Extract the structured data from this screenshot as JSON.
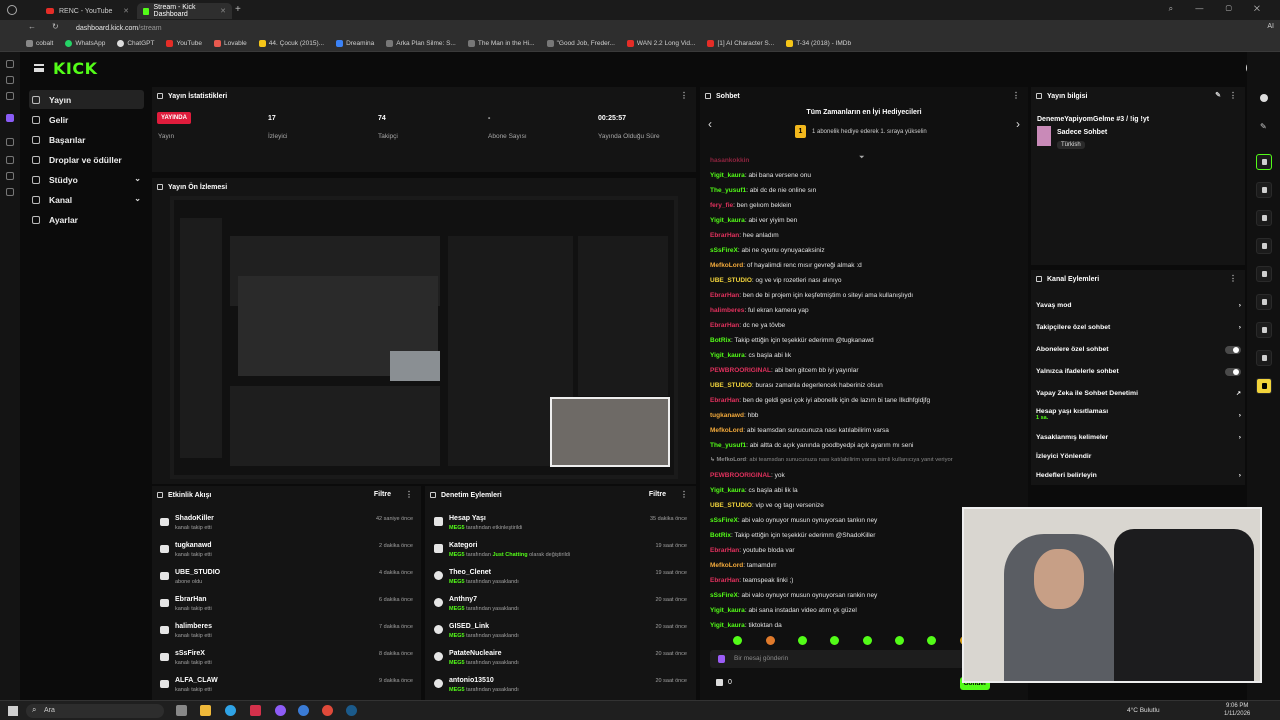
{
  "browser": {
    "tabs": [
      {
        "label": "RENC - YouTube"
      },
      {
        "label": "Stream - Kick Dashboard"
      }
    ],
    "url_host": "dashboard.kick.com",
    "url_path": "/stream",
    "bookmarks": [
      "cobalt",
      "WhatsApp",
      "ChatGPT",
      "YouTube",
      "Lovable",
      "44. Çocuk (2015)...",
      "Dreamina",
      "Arka Plan Silme: S...",
      "The Man in the Hi...",
      "\"Good Job, Freder...",
      "WAN 2.2 Long Vid...",
      "[1] AI Character S...",
      "T-34 (2018) - IMDb"
    ],
    "zoom_label": "AI"
  },
  "sidebar": {
    "logo": "KICK",
    "items": [
      {
        "label": "Yayın"
      },
      {
        "label": "Gelir"
      },
      {
        "label": "Başarılar"
      },
      {
        "label": "Droplar ve ödüller"
      },
      {
        "label": "Stüdyo"
      },
      {
        "label": "Kanal"
      },
      {
        "label": "Ayarlar"
      }
    ]
  },
  "stats": {
    "title": "Yayın İstatistikleri",
    "live_badge": "YAYINDA",
    "live_label": "Yayın",
    "viewers_value": "17",
    "viewers_label": "İzleyici",
    "followers_value": "74",
    "followers_label": "Takipçi",
    "subs_value": "-",
    "subs_label": "Abone Sayısı",
    "uptime_value": "00:25:57",
    "uptime_label": "Yayında Olduğu Süre"
  },
  "preview": {
    "title": "Yayın Ön İzlemesi"
  },
  "activity": {
    "title": "Etkinlik Akışı",
    "filter": "Filtre",
    "items": [
      {
        "name": "ShadoKiller",
        "sub": "kanalı takip etti",
        "time": "42 saniye önce"
      },
      {
        "name": "tugkanawd",
        "sub": "kanalı takip etti",
        "time": "2 dakika önce"
      },
      {
        "name": "UBE_STUDIO",
        "sub": "abone oldu",
        "time": "4 dakika önce"
      },
      {
        "name": "EbrarHan",
        "sub": "kanalı takip etti",
        "time": "6 dakika önce"
      },
      {
        "name": "halimberes",
        "sub": "kanalı takip etti",
        "time": "7 dakika önce"
      },
      {
        "name": "sSsFireX",
        "sub": "kanalı takip etti",
        "time": "8 dakika önce"
      },
      {
        "name": "ALFA_CLAW",
        "sub": "kanalı takip etti",
        "time": "9 dakika önce"
      }
    ]
  },
  "moderation": {
    "title": "Denetim Eylemleri",
    "filter": "Filtre",
    "items": [
      {
        "name": "Hesap Yaşı",
        "actor": "MEG5",
        "rest": "tarafından etkinleştirildi",
        "extra": "",
        "tail": "",
        "time": "35 dakika önce"
      },
      {
        "name": "Kategori",
        "actor": "MEG5",
        "rest": "tarafından",
        "extra": "Just Chatting",
        "tail": "olarak değiştirildi",
        "time": "19 saat önce"
      },
      {
        "name": "Theo_Clenet",
        "actor": "MEG5",
        "rest": "tarafından yasaklandı",
        "extra": "",
        "tail": "",
        "time": "19 saat önce"
      },
      {
        "name": "Anthny7",
        "actor": "MEG5",
        "rest": "tarafından yasaklandı",
        "extra": "",
        "tail": "",
        "time": "20 saat önce"
      },
      {
        "name": "GISED_Link",
        "actor": "MEG5",
        "rest": "tarafından yasaklandı",
        "extra": "",
        "tail": "",
        "time": "20 saat önce"
      },
      {
        "name": "PatateNucleaire",
        "actor": "MEG5",
        "rest": "tarafından yasaklandı",
        "extra": "",
        "tail": "",
        "time": "20 saat önce"
      },
      {
        "name": "antonio13510",
        "actor": "MEG5",
        "rest": "tarafından yasaklandı",
        "extra": "",
        "tail": "",
        "time": "20 saat önce"
      }
    ]
  },
  "chat": {
    "title": "Sohbet",
    "gift_title": "Tüm Zamanların en İyi Hediyecileri",
    "gift_rank": "1",
    "gift_sub": "1 abonelik hediye ederek 1. sıraya yükselin",
    "input_placeholder": "Bir mesaj gönderin",
    "count": "0",
    "send": "Gönder",
    "messages": [
      {
        "user": "hasankokkin",
        "color": "#e0315d",
        "text": ""
      },
      {
        "user": "Yigit_kaura",
        "color": "#53fc18",
        "text": "abi bana versene onu"
      },
      {
        "user": "The_yusuf1",
        "color": "#53fc18",
        "text": "abi dc de nie online sın"
      },
      {
        "user": "fery_fie",
        "color": "#e0315d",
        "text": "ben gelıom beklein"
      },
      {
        "user": "Yigit_kaura",
        "color": "#53fc18",
        "text": "abi ver yiyim ben"
      },
      {
        "user": "EbrarHan",
        "color": "#e0315d",
        "text": "hee anladım"
      },
      {
        "user": "sSsFireX",
        "color": "#53fc18",
        "text": "abi ne oyunu oynuyacaksiniz"
      },
      {
        "user": "MefkoLord",
        "color": "#f2a93b",
        "text": "of hayalimdi renc mısır gevreği almak :d"
      },
      {
        "user": "UBE_STUDIO",
        "color": "#f2d43b",
        "text": "og ve vip rozetleri nası alınıyo"
      },
      {
        "user": "EbrarHan",
        "color": "#e0315d",
        "text": "ben de bi projem için keşfetmiştim o siteyi ama kullanışlıydı"
      },
      {
        "user": "halimberes",
        "color": "#e0315d",
        "text": "ful ekran kamera yap"
      },
      {
        "user": "EbrarHan",
        "color": "#e0315d",
        "text": "dc ne ya tövbe"
      },
      {
        "user": "BotRix",
        "color": "#53fc18",
        "text": "Takip ettiğin için teşekkür ederimm @tugkanawd"
      },
      {
        "user": "Yigit_kaura",
        "color": "#53fc18",
        "text": "cs başla abi lık"
      },
      {
        "user": "PEWBROORIGINAL",
        "color": "#e0315d",
        "text": "abi ben gitcem bb iyi yayınlar"
      },
      {
        "user": "UBE_STUDIO",
        "color": "#f2d43b",
        "text": "burası zamanla degerlencek haberiniz olsun"
      },
      {
        "user": "EbrarHan",
        "color": "#e0315d",
        "text": "ben de geldi gesi çok iyi abonelik için de lazım bi tane İlkdhfgldjfg"
      },
      {
        "user": "tugkanawd",
        "color": "#f2a93b",
        "text": "hbb"
      },
      {
        "user": "MefkoLord",
        "color": "#f2a93b",
        "text": "abi teamsdan sunucunuza nası katılabilirim varsa"
      },
      {
        "user": "The_yusuf1",
        "color": "#53fc18",
        "text": "abi altta dc açık yanında goodbyedpi açık ayarım mı seni"
      },
      {
        "user": "↳ MefkoLord",
        "color": "#8a8a8a",
        "text": "abi teamsdan sunucunuza nası katılabilirim varsa isimli kullanıcıya yanıt veriyor"
      },
      {
        "user": "PEWBROORIGINAL",
        "color": "#e0315d",
        "text": "yok"
      },
      {
        "user": "Yigit_kaura",
        "color": "#53fc18",
        "text": "cs başla abi lik la"
      },
      {
        "user": "UBE_STUDIO",
        "color": "#f2d43b",
        "text": "vip ve og tagı versenize"
      },
      {
        "user": "sSsFireX",
        "color": "#53fc18",
        "text": "abi valo oynuyor musun oynuyorsan tankın ney"
      },
      {
        "user": "BotRix",
        "color": "#53fc18",
        "text": "Takip ettiğin için teşekkür ederimm @ShadoKiller"
      },
      {
        "user": "EbrarHan",
        "color": "#e0315d",
        "text": "youtube bloda var"
      },
      {
        "user": "MefkoLord",
        "color": "#f2a93b",
        "text": "tamamdırr"
      },
      {
        "user": "EbrarHan",
        "color": "#e0315d",
        "text": "teamspeak linki ;)"
      },
      {
        "user": "sSsFireX",
        "color": "#53fc18",
        "text": "abi valo oynuyor musun oynuyorsan rankin ney"
      },
      {
        "user": "Yigit_kaura",
        "color": "#53fc18",
        "text": "abi sana instadan video atım çk güzel"
      },
      {
        "user": "Yigit_kaura",
        "color": "#53fc18",
        "text": "tiktoktan da"
      }
    ]
  },
  "stream_info": {
    "title": "Yayın bilgisi",
    "stream_title": "DenemeYapiyomGelme #3 / !ig !yt",
    "category": "Sadece Sohbet",
    "language": "Türkish"
  },
  "channel_actions": {
    "title": "Kanal Eylemleri",
    "items": [
      {
        "label": "Yavaş mod",
        "kind": "arrow",
        "sub": ""
      },
      {
        "label": "Takipçilere özel sohbet",
        "kind": "arrow",
        "sub": ""
      },
      {
        "label": "Abonelere özel sohbet",
        "kind": "toggle",
        "sub": ""
      },
      {
        "label": "Yalnızca ifadelerle sohbet",
        "kind": "toggle",
        "sub": ""
      },
      {
        "label": "Yapay Zeka ile Sohbet Denetimi",
        "kind": "ext",
        "sub": ""
      },
      {
        "label": "Hesap yaşı kısıtlaması",
        "kind": "arrow",
        "sub": "1 sa."
      },
      {
        "label": "Yasaklanmış kelimeler",
        "kind": "arrow",
        "sub": ""
      },
      {
        "label": "İzleyici Yönlendir",
        "kind": "none",
        "sub": ""
      },
      {
        "label": "Hedefleri belirleyin",
        "kind": "arrow",
        "sub": ""
      }
    ]
  },
  "taskbar": {
    "search": "Ara",
    "weather": "4°C  Bulutlu",
    "time": "9:06 PM",
    "date": "1/11/2026"
  },
  "colors": {
    "accent": "#53fc18",
    "live": "#e01c3c",
    "panel": "#141414"
  }
}
